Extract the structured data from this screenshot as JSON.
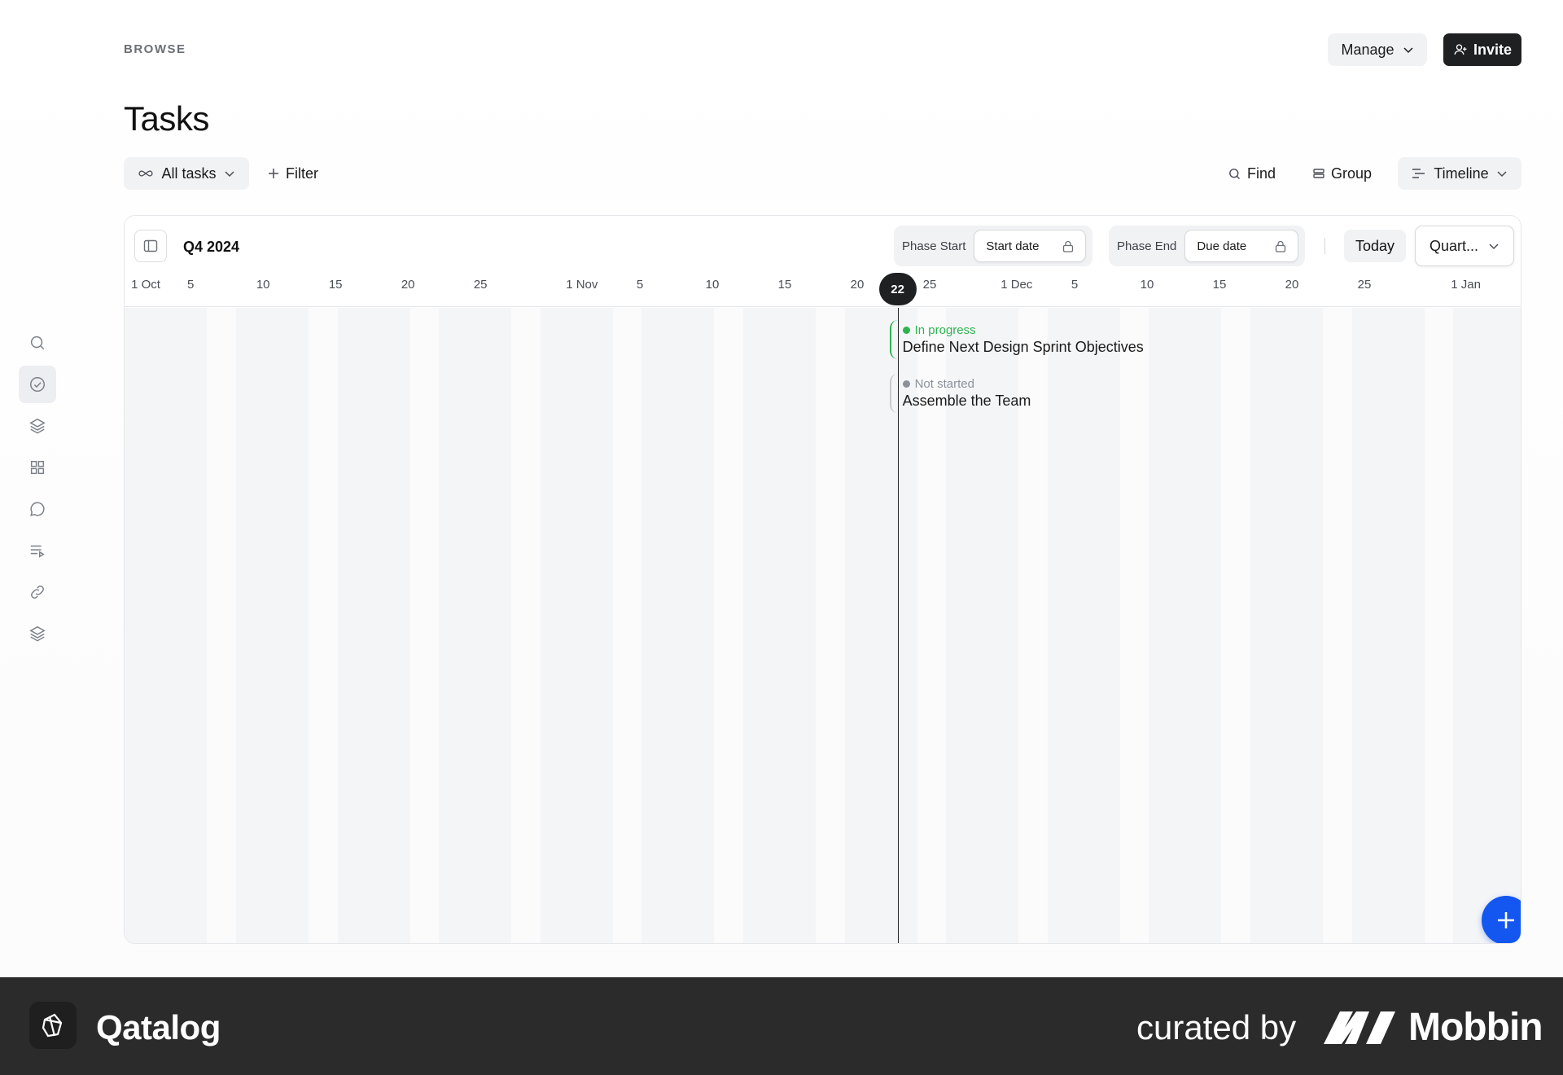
{
  "header": {
    "section_label": "BROWSE",
    "title": "Tasks",
    "manage_label": "Manage",
    "invite_label": "Invite"
  },
  "sidebar": {
    "items": [
      {
        "icon": "search-icon",
        "active": false
      },
      {
        "icon": "check-circle-icon",
        "active": true
      },
      {
        "icon": "layers-icon",
        "active": false
      },
      {
        "icon": "grid-icon",
        "active": false
      },
      {
        "icon": "chat-bubble-icon",
        "active": false
      },
      {
        "icon": "playlist-icon",
        "active": false
      },
      {
        "icon": "link-icon",
        "active": false
      },
      {
        "icon": "stack-icon",
        "active": false
      }
    ]
  },
  "toolbar": {
    "view_filter_label": "All tasks",
    "filter_label": "Filter",
    "find_label": "Find",
    "group_label": "Group",
    "layout_label": "Timeline"
  },
  "timeline": {
    "period_label": "Q4 2024",
    "phase_start_label": "Phase Start",
    "phase_start_chip": "Start date",
    "phase_end_label": "Phase End",
    "phase_end_chip": "Due date",
    "today_label": "Today",
    "zoom_label": "Quart...",
    "today_marker": "22",
    "day_labels": [
      "1 Oct",
      "5",
      "10",
      "15",
      "20",
      "25",
      "1 Nov",
      "5",
      "10",
      "15",
      "20",
      "25",
      "1 Dec",
      "5",
      "10",
      "15",
      "20",
      "25",
      "1 Jan"
    ],
    "tasks": [
      {
        "status": "In progress",
        "status_color": "#2fb350",
        "name": "Define Next Design Sprint Objectives"
      },
      {
        "status": "Not started",
        "status_color": "#8b919b",
        "name": "Assemble the Team"
      }
    ]
  },
  "colors": {
    "accent": "#1357f0",
    "dark": "#1f2022"
  },
  "footer": {
    "brand_name": "Qatalog",
    "curated_label": "curated by",
    "curator_name": "Mobbin"
  }
}
